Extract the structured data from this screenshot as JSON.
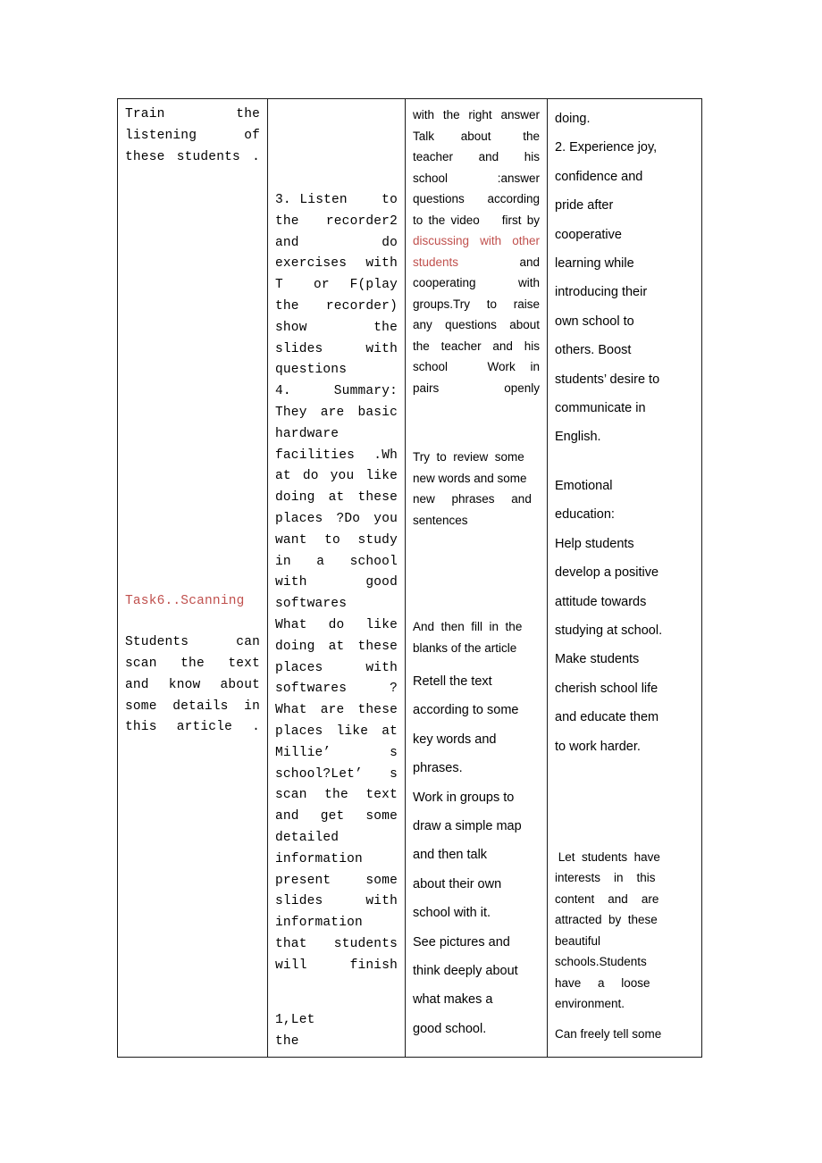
{
  "document": {
    "kind": "lesson-plan-table",
    "page_background": "#ffffff",
    "border_color": "#1a1a1a",
    "accent_red": "#c0504d"
  },
  "table": {
    "columns": [
      {
        "id": "col-procedure-left",
        "name": "teacher-activity-column"
      },
      {
        "id": "col-steps",
        "name": "steps-column"
      },
      {
        "id": "col-student-activity",
        "name": "student-activity-column"
      },
      {
        "id": "col-aims",
        "name": "aims-column"
      }
    ],
    "col1": {
      "para1": "Train   the\nlistening   of\nthese students .",
      "task_heading": "Task6..Scanning",
      "para2": "Students   can\nscan  the  text\nand know about\nsome details in\nthis article ."
    },
    "col2": {
      "para1": "3. Listen    to\nthe   recorder2\nand         do\nexercises  with\nT   or  F(play\nthe   recorder)\nshow        the\nslides     with\nquestions\n4. Summary:\nThey are basic\nhardware\nfacilities .Wh\nat do you like\ndoing at these\nplaces ?Do you\nwant  to  study\nin   a   school\nwith       good\nsoftwares\nWhat  do  like\ndoing at these\nplaces    with\nsoftwares ?\nWhat are these\nplaces like at\nMillie’ s\nschool?Let’ s\nscan  the  text\nand  get  some\ndetailed\ninformation\npresent   some\nslides    with\ninformation\nthat  students\nwill finish",
      "last_line": "1,Let        the"
    },
    "col3": {
      "para1": "with the right answer\nTalk     about      the\nteacher     and     his\nschool          :answer\nquestions   according\nto the video    first by ",
      "para1_red": "discussing with other\nstudents",
      "para1_cont": "            and\ncooperating         with\ngroups.Try   to   raise\nany questions about\nthe  teacher  and  his\nschool        Work   in\npairs openly",
      "para2": "Try  to  review  some\nnew words and some\nnew     phrases     and\nsentences",
      "para3": "And  then  fill  in  the\nblanks of the article",
      "para4": "Retell the text\naccording to some\nkey words and\nphrases.\nWork in groups to\ndraw a simple map\nand then talk\nabout their own\nschool with it.\nSee pictures and\nthink deeply about\nwhat makes a\ngood school."
    },
    "col4": {
      "para1": "doing.\n2. Experience joy,\nconfidence and\npride after\ncooperative\nlearning while\nintroducing their\nown school to\nothers. Boost\nstudents’ desire to\ncommunicate in\nEnglish.",
      "para2": "Emotional\neducation:\nHelp students\ndevelop a positive\nattitude towards\nstudying at school.\nMake students\ncherish school life\nand educate them\nto work harder.",
      "para3": " Let  students  have\ninterests    in    this\ncontent    and    are\nattracted  by  these\nbeautiful\nschools.Students\nhave     a     loose\nenvironment.",
      "para4": "Can freely tell some"
    }
  }
}
